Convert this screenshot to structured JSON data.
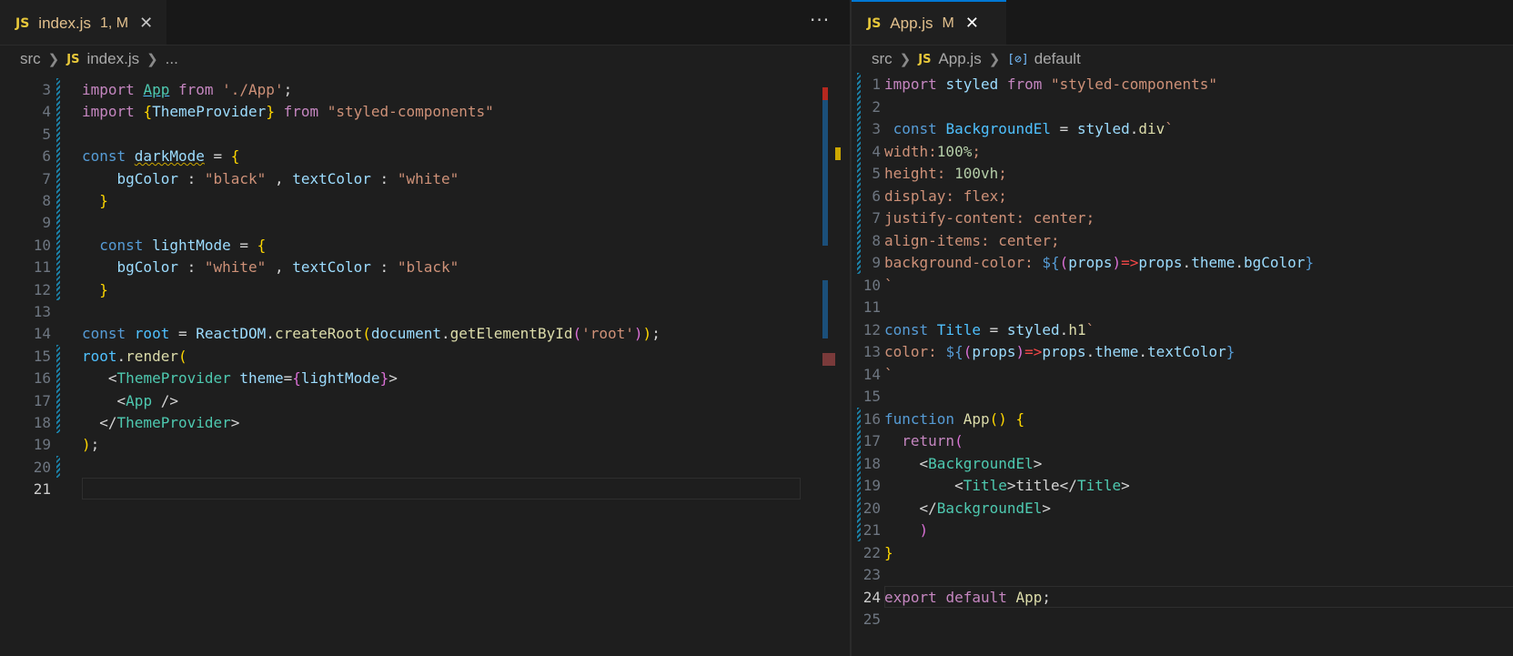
{
  "left_pane": {
    "tab": {
      "file_name": "index.js",
      "status": "1, M",
      "language_badge": "JS",
      "close_icon": "close-icon"
    },
    "more_actions": "···",
    "breadcrumb": [
      "src",
      "index.js",
      "..."
    ],
    "lines": [
      {
        "n": "3",
        "tokens": [
          [
            "kw",
            "import "
          ],
          [
            "link",
            "App"
          ],
          [
            "kw",
            " from "
          ],
          [
            "str",
            "'./App'"
          ],
          [
            "pun",
            ";"
          ]
        ]
      },
      {
        "n": "4",
        "tokens": [
          [
            "kw",
            "import "
          ],
          [
            "br1",
            "{"
          ],
          [
            "var",
            "ThemeProvider"
          ],
          [
            "br1",
            "}"
          ],
          [
            "kw",
            " from "
          ],
          [
            "str",
            "\"styled-components\""
          ]
        ]
      },
      {
        "n": "5",
        "tokens": []
      },
      {
        "n": "6",
        "tokens": [
          [
            "decl",
            "const "
          ],
          [
            "squig",
            "darkMode"
          ],
          [
            "pun",
            " = "
          ],
          [
            "br1",
            "{"
          ]
        ]
      },
      {
        "n": "7",
        "tokens": [
          [
            "pun",
            "    "
          ],
          [
            "var",
            "bgColor"
          ],
          [
            "pun",
            " : "
          ],
          [
            "str",
            "\"black\""
          ],
          [
            "pun",
            " , "
          ],
          [
            "var",
            "textColor"
          ],
          [
            "pun",
            " : "
          ],
          [
            "str",
            "\"white\""
          ]
        ]
      },
      {
        "n": "8",
        "tokens": [
          [
            "pun",
            "  "
          ],
          [
            "br1",
            "}"
          ]
        ]
      },
      {
        "n": "9",
        "tokens": []
      },
      {
        "n": "10",
        "tokens": [
          [
            "pun",
            "  "
          ],
          [
            "decl",
            "const "
          ],
          [
            "var",
            "lightMode"
          ],
          [
            "pun",
            " = "
          ],
          [
            "br1",
            "{"
          ]
        ]
      },
      {
        "n": "11",
        "tokens": [
          [
            "pun",
            "    "
          ],
          [
            "var",
            "bgColor"
          ],
          [
            "pun",
            " : "
          ],
          [
            "str",
            "\"white\""
          ],
          [
            "pun",
            " , "
          ],
          [
            "var",
            "textColor"
          ],
          [
            "pun",
            " : "
          ],
          [
            "str",
            "\"black\""
          ]
        ]
      },
      {
        "n": "12",
        "tokens": [
          [
            "pun",
            "  "
          ],
          [
            "br1",
            "}"
          ]
        ]
      },
      {
        "n": "13",
        "tokens": []
      },
      {
        "n": "14",
        "tokens": [
          [
            "decl",
            "const "
          ],
          [
            "const",
            "root"
          ],
          [
            "pun",
            " = "
          ],
          [
            "var",
            "ReactDOM"
          ],
          [
            "pun",
            "."
          ],
          [
            "fn",
            "createRoot"
          ],
          [
            "br1",
            "("
          ],
          [
            "var",
            "document"
          ],
          [
            "pun",
            "."
          ],
          [
            "fn",
            "getElementById"
          ],
          [
            "br2",
            "("
          ],
          [
            "str",
            "'root'"
          ],
          [
            "br2",
            ")"
          ],
          [
            "br1",
            ")"
          ],
          [
            "pun",
            ";"
          ]
        ]
      },
      {
        "n": "15",
        "tokens": [
          [
            "const",
            "root"
          ],
          [
            "pun",
            "."
          ],
          [
            "fn",
            "render"
          ],
          [
            "br1",
            "("
          ]
        ]
      },
      {
        "n": "16",
        "tokens": [
          [
            "pun",
            "   "
          ],
          [
            "pun",
            "<"
          ],
          [
            "tag",
            "ThemeProvider"
          ],
          [
            "var",
            " theme"
          ],
          [
            "pun",
            "="
          ],
          [
            "br2",
            "{"
          ],
          [
            "var",
            "lightMode"
          ],
          [
            "br2",
            "}"
          ],
          [
            "pun",
            ">"
          ]
        ]
      },
      {
        "n": "17",
        "tokens": [
          [
            "pun",
            "    "
          ],
          [
            "pun",
            "<"
          ],
          [
            "tag",
            "App"
          ],
          [
            "pun",
            " />"
          ]
        ]
      },
      {
        "n": "18",
        "tokens": [
          [
            "pun",
            "  "
          ],
          [
            "pun",
            "</"
          ],
          [
            "tag",
            "ThemeProvider"
          ],
          [
            "pun",
            ">"
          ]
        ]
      },
      {
        "n": "19",
        "tokens": [
          [
            "br1",
            ")"
          ],
          [
            "pun",
            ";"
          ]
        ]
      },
      {
        "n": "20",
        "tokens": []
      },
      {
        "n": "21",
        "tokens": []
      }
    ],
    "current_line": "21"
  },
  "right_pane": {
    "tab": {
      "file_name": "App.js",
      "status": "M",
      "language_badge": "JS",
      "close_icon": "close-icon"
    },
    "breadcrumb": [
      "src",
      "App.js",
      "default"
    ],
    "lines": [
      {
        "n": "1",
        "tokens": [
          [
            "kw",
            "import "
          ],
          [
            "var",
            "styled"
          ],
          [
            "kw",
            " from "
          ],
          [
            "str",
            "\"styled-components\""
          ]
        ]
      },
      {
        "n": "2",
        "tokens": []
      },
      {
        "n": "3",
        "tokens": [
          [
            "pun",
            " "
          ],
          [
            "decl",
            "const "
          ],
          [
            "const",
            "BackgroundEl"
          ],
          [
            "pun",
            " = "
          ],
          [
            "var",
            "styled"
          ],
          [
            "pun",
            "."
          ],
          [
            "fn",
            "div"
          ],
          [
            "str",
            "`"
          ]
        ]
      },
      {
        "n": "4",
        "tokens": [
          [
            "str",
            "width:"
          ],
          [
            "num",
            "100%"
          ],
          [
            "str",
            ";"
          ]
        ]
      },
      {
        "n": "5",
        "tokens": [
          [
            "str",
            "height: "
          ],
          [
            "num",
            "100vh"
          ],
          [
            "str",
            ";"
          ]
        ]
      },
      {
        "n": "6",
        "tokens": [
          [
            "str",
            "display: "
          ],
          [
            "str",
            "flex"
          ],
          [
            "str",
            ";"
          ]
        ]
      },
      {
        "n": "7",
        "tokens": [
          [
            "str",
            "justify-content: "
          ],
          [
            "str",
            "center"
          ],
          [
            "str",
            ";"
          ]
        ]
      },
      {
        "n": "8",
        "tokens": [
          [
            "str",
            "align-items: "
          ],
          [
            "str",
            "center"
          ],
          [
            "str",
            ";"
          ]
        ]
      },
      {
        "n": "9",
        "tokens": [
          [
            "str",
            "background-color: "
          ],
          [
            "decl",
            "${"
          ],
          [
            "br2",
            "("
          ],
          [
            "var",
            "props"
          ],
          [
            "br2",
            ")"
          ],
          [
            "arr",
            "=>"
          ],
          [
            "var",
            "props"
          ],
          [
            "pun",
            "."
          ],
          [
            "var",
            "theme"
          ],
          [
            "pun",
            "."
          ],
          [
            "var",
            "bgColor"
          ],
          [
            "decl",
            "}"
          ]
        ]
      },
      {
        "n": "10",
        "tokens": [
          [
            "str",
            "`"
          ]
        ]
      },
      {
        "n": "11",
        "tokens": []
      },
      {
        "n": "12",
        "tokens": [
          [
            "decl",
            "const "
          ],
          [
            "const",
            "Title"
          ],
          [
            "pun",
            " = "
          ],
          [
            "var",
            "styled"
          ],
          [
            "pun",
            "."
          ],
          [
            "fn",
            "h1"
          ],
          [
            "str",
            "`"
          ]
        ]
      },
      {
        "n": "13",
        "tokens": [
          [
            "str",
            "color: "
          ],
          [
            "decl",
            "${"
          ],
          [
            "br2",
            "("
          ],
          [
            "var",
            "props"
          ],
          [
            "br2",
            ")"
          ],
          [
            "arr",
            "=>"
          ],
          [
            "var",
            "props"
          ],
          [
            "pun",
            "."
          ],
          [
            "var",
            "theme"
          ],
          [
            "pun",
            "."
          ],
          [
            "var",
            "textColor"
          ],
          [
            "decl",
            "}"
          ]
        ]
      },
      {
        "n": "14",
        "tokens": [
          [
            "str",
            "`"
          ]
        ]
      },
      {
        "n": "15",
        "tokens": []
      },
      {
        "n": "16",
        "tokens": [
          [
            "decl",
            "function "
          ],
          [
            "fn",
            "App"
          ],
          [
            "br1",
            "()"
          ],
          [
            "pun",
            " "
          ],
          [
            "br1",
            "{"
          ]
        ]
      },
      {
        "n": "17",
        "tokens": [
          [
            "pun",
            "  "
          ],
          [
            "kw",
            "return"
          ],
          [
            "br2",
            "("
          ]
        ]
      },
      {
        "n": "18",
        "tokens": [
          [
            "pun",
            "    <"
          ],
          [
            "tag",
            "BackgroundEl"
          ],
          [
            "pun",
            ">"
          ]
        ]
      },
      {
        "n": "19",
        "tokens": [
          [
            "pun",
            "        <"
          ],
          [
            "tag",
            "Title"
          ],
          [
            "pun",
            ">title</"
          ],
          [
            "tag",
            "Title"
          ],
          [
            "pun",
            ">"
          ]
        ]
      },
      {
        "n": "20",
        "tokens": [
          [
            "pun",
            "    </"
          ],
          [
            "tag",
            "BackgroundEl"
          ],
          [
            "pun",
            ">"
          ]
        ]
      },
      {
        "n": "21",
        "tokens": [
          [
            "pun",
            "    "
          ],
          [
            "br2",
            ")"
          ]
        ]
      },
      {
        "n": "22",
        "tokens": [
          [
            "br1",
            "}"
          ]
        ]
      },
      {
        "n": "23",
        "tokens": []
      },
      {
        "n": "24",
        "tokens": [
          [
            "kw",
            "export "
          ],
          [
            "kw",
            "default "
          ],
          [
            "fn",
            "App"
          ],
          [
            "pun",
            ";"
          ]
        ]
      },
      {
        "n": "25",
        "tokens": []
      }
    ],
    "current_line": "24"
  },
  "colors": {
    "editor_bg": "#1e1e1e",
    "tab_modified_text": "#e2c08d",
    "js_badge": "#e8c83a",
    "gutter_modified": "#1b81a8"
  }
}
